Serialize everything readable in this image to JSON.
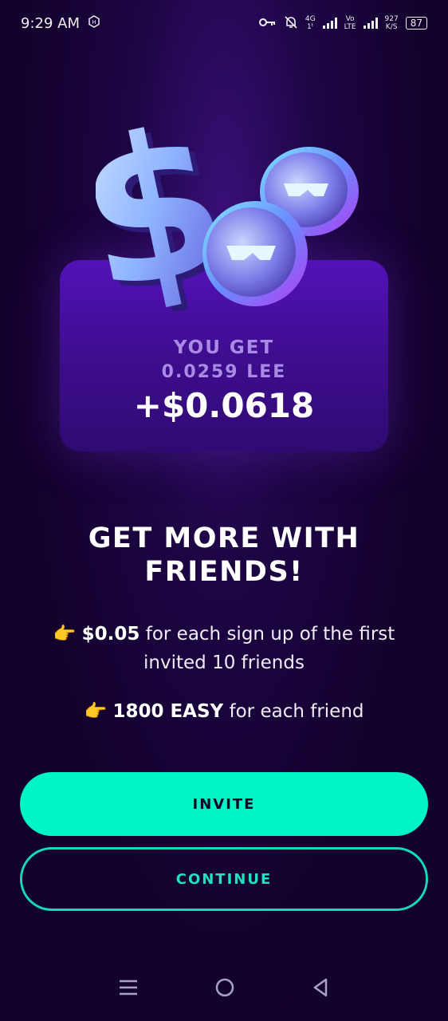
{
  "status_bar": {
    "time": "9:29 AM",
    "network_top": "4G",
    "network_bottom": "1ᵗ",
    "volte_top": "Vo",
    "volte_bottom": "LTE",
    "speed_value": "927",
    "speed_unit": "K/S",
    "battery": "87"
  },
  "reward": {
    "label": "YOU GET",
    "token_amount": "0.0259 LEE",
    "usd_amount": "+$0.0618"
  },
  "headline": "GET MORE WITH FRIENDS!",
  "perks": [
    {
      "emoji": "👉",
      "highlight": "$0.05",
      "text": " for each sign up of the first invited 10 friends"
    },
    {
      "emoji": "👉",
      "highlight": "1800 EASY",
      "text": " for each friend"
    }
  ],
  "buttons": {
    "invite": "INVITE",
    "continue": "CONTINUE"
  },
  "colors": {
    "accent": "#00f5c4",
    "background": "#14022f",
    "card": "#4a10a8"
  },
  "icons": [
    "menu-icon",
    "home-circle-icon",
    "back-triangle-icon",
    "key-icon",
    "bell-off-icon",
    "app-badge-icon"
  ]
}
